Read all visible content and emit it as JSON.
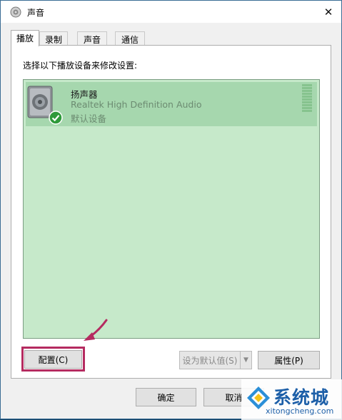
{
  "window": {
    "title": "声音",
    "close_glyph": "✕"
  },
  "tabs": [
    {
      "label": "播放",
      "active": true
    },
    {
      "label": "录制",
      "active": false
    },
    {
      "label": "声音",
      "active": false
    },
    {
      "label": "通信",
      "active": false
    }
  ],
  "panel": {
    "prompt": "选择以下播放设备来修改设置:",
    "devices": [
      {
        "name": "扬声器",
        "driver": "Realtek High Definition Audio",
        "status": "默认设备",
        "icon": "speaker-icon",
        "badge": "green-check-icon"
      }
    ]
  },
  "buttons": {
    "configure": "配置(C)",
    "set_default": "设为默认值(S)",
    "properties": "属性(P)",
    "ok": "确定",
    "cancel": "取消"
  },
  "watermark": {
    "text": "系统城",
    "url": "xitongcheng.com"
  },
  "colors": {
    "list_bg": "#c6e9ca",
    "selected_bg": "#a6d7ae",
    "highlight": "#b52b60",
    "watermark": "#1d5fa8"
  }
}
